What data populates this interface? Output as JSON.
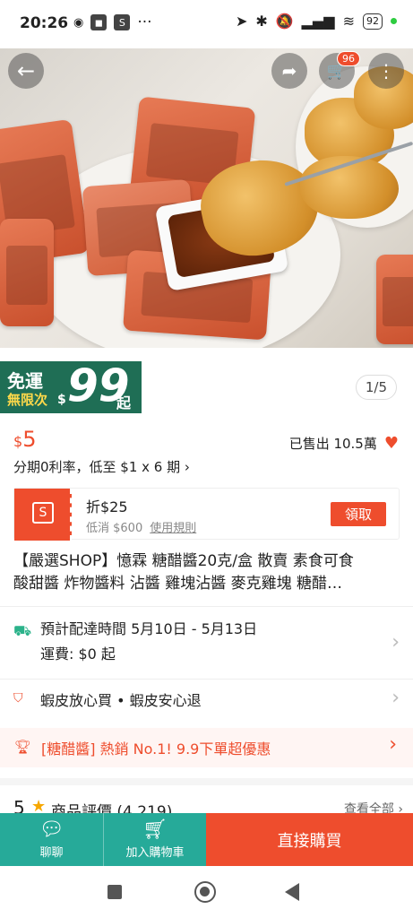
{
  "status_bar": {
    "time": "20:26",
    "app_badge": "S",
    "more": "···",
    "battery": "92"
  },
  "header": {
    "cart_count": "96"
  },
  "promo": {
    "line1": "免運",
    "line2": "無限次",
    "currency": "$",
    "amount": "99",
    "suffix": "起"
  },
  "gallery": {
    "pager": "1/5"
  },
  "product": {
    "currency": "$",
    "price": "5",
    "sold": "已售出 10.5萬",
    "installment": "分期0利率，低至 $1 x 6 期 ›",
    "title_line1": "【嚴選SHOP】憶霖 糖醋醬20克/盒 散賣 素食可食",
    "title_line2": "酸甜醬 炸物醬料 沾醬 雞塊沾醬 麥克雞塊 糖醋…"
  },
  "coupon": {
    "title": "折$25",
    "min": "低消 $600",
    "rule": "使用規則",
    "claim": "領取"
  },
  "shipping": {
    "eta": "預計配達時間 5月10日 - 5月13日",
    "fee": "運費:  $0 起"
  },
  "guarantee": {
    "text": "蝦皮放心買  •  蝦皮安心退"
  },
  "hot_banner": {
    "text": "[糖醋醬] 熱銷 No.1!  9.9下單超優惠"
  },
  "reviews": {
    "score": "5",
    "title": "商品評價 (4,219)",
    "view_all": "查看全部 ›"
  },
  "bottom_bar": {
    "chat": "聊聊",
    "add_cart": "加入購物車",
    "buy_now": "直接購買"
  },
  "colors": {
    "brand": "#ee4d2d",
    "teal": "#26aa99",
    "ribbon": "#1f6e55"
  }
}
